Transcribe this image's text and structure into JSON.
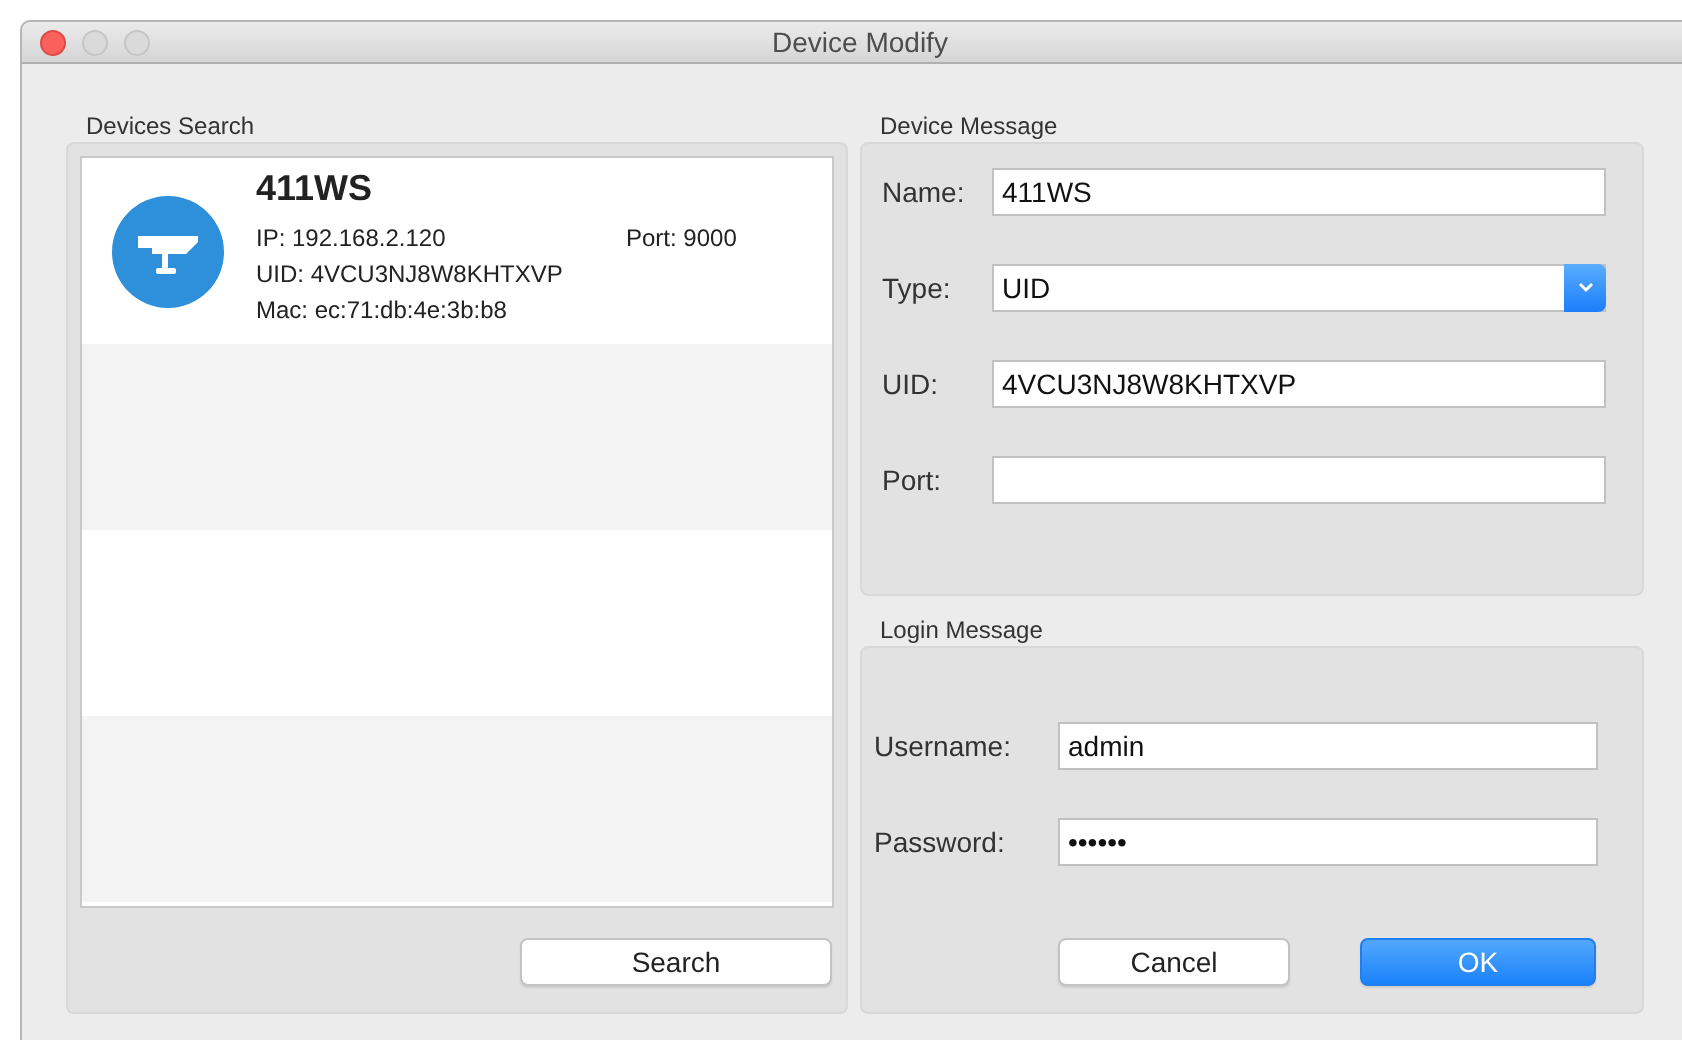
{
  "window": {
    "title": "Device Modify"
  },
  "devices_search": {
    "title": "Devices Search",
    "devices": [
      {
        "name": "411WS",
        "ip": "IP: 192.168.2.120",
        "port": "Port: 9000",
        "uid": "UID: 4VCU3NJ8W8KHTXVP",
        "mac": "Mac: ec:71:db:4e:3b:b8"
      }
    ],
    "search_button": "Search"
  },
  "device_message": {
    "title": "Device Message",
    "fields": [
      {
        "label": "Name:",
        "kind": "text",
        "value": "411WS"
      },
      {
        "label": "Type:",
        "kind": "select",
        "value": "UID"
      },
      {
        "label": "UID:",
        "kind": "text",
        "value": "4VCU3NJ8W8KHTXVP"
      },
      {
        "label": "Port:",
        "kind": "text"
      }
    ]
  },
  "login_message": {
    "title": "Login Message",
    "fields": [
      {
        "label": "Username:",
        "kind": "text",
        "value": "admin"
      },
      {
        "label": "Password:",
        "kind": "text",
        "value": "••••••"
      }
    ],
    "buttons": [
      {
        "label": "Cancel",
        "kind": "default"
      },
      {
        "label": "OK",
        "kind": "primary"
      }
    ]
  }
}
